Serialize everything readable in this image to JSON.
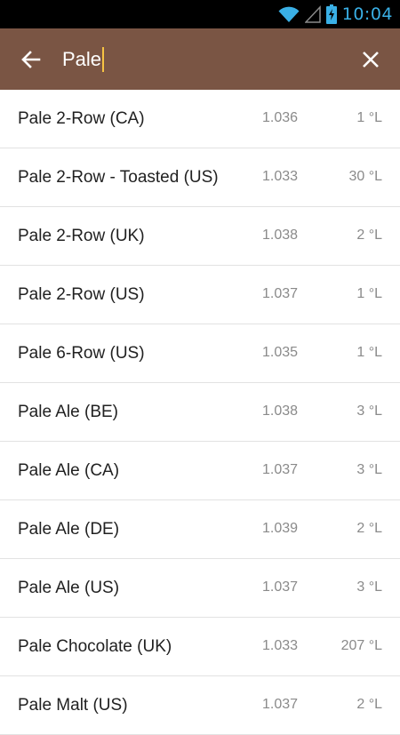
{
  "status": {
    "time": "10:04"
  },
  "search": {
    "query": "Pale"
  },
  "results": [
    {
      "name": "Pale 2-Row (CA)",
      "gravity": "1.036",
      "color": "1 °L"
    },
    {
      "name": "Pale 2-Row - Toasted (US)",
      "gravity": "1.033",
      "color": "30 °L"
    },
    {
      "name": "Pale 2-Row (UK)",
      "gravity": "1.038",
      "color": "2 °L"
    },
    {
      "name": "Pale 2-Row (US)",
      "gravity": "1.037",
      "color": "1 °L"
    },
    {
      "name": "Pale 6-Row (US)",
      "gravity": "1.035",
      "color": "1 °L"
    },
    {
      "name": "Pale Ale (BE)",
      "gravity": "1.038",
      "color": "3 °L"
    },
    {
      "name": "Pale Ale (CA)",
      "gravity": "1.037",
      "color": "3 °L"
    },
    {
      "name": "Pale Ale (DE)",
      "gravity": "1.039",
      "color": "2 °L"
    },
    {
      "name": "Pale Ale (US)",
      "gravity": "1.037",
      "color": "3 °L"
    },
    {
      "name": "Pale Chocolate (UK)",
      "gravity": "1.033",
      "color": "207 °L"
    },
    {
      "name": "Pale Malt (US)",
      "gravity": "1.037",
      "color": "2 °L"
    }
  ]
}
